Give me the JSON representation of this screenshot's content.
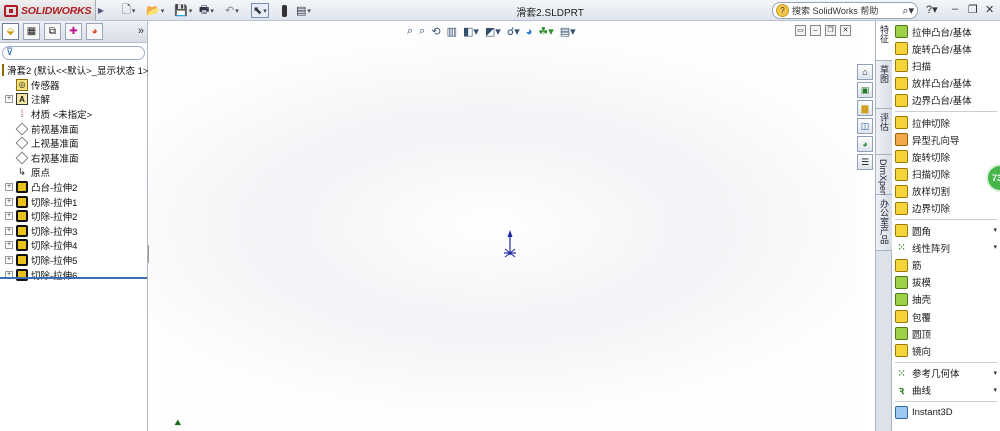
{
  "app": {
    "logo_text": "SOLIDWORKS",
    "document_title": "滑套2.SLDPRT",
    "search_placeholder": "搜索 SolidWorks 帮助",
    "help_label": "?"
  },
  "toolbar": {
    "icons": [
      "new-icon",
      "open-icon",
      "save-icon",
      "print-icon",
      "undo-icon",
      "select-icon",
      "traffic-light-icon",
      "options-icon"
    ]
  },
  "feature_tree": {
    "root_label": "滑套2 (默认<<默认>_显示状态 1>)",
    "nodes": [
      {
        "label": "传感器",
        "icon": "sensor-icon",
        "expandable": false
      },
      {
        "label": "注解",
        "icon": "annotation-icon",
        "expandable": true
      },
      {
        "label": "材质 <未指定>",
        "icon": "material-icon",
        "expandable": false
      },
      {
        "label": "前视基准面",
        "icon": "plane-icon",
        "expandable": false
      },
      {
        "label": "上视基准面",
        "icon": "plane-icon",
        "expandable": false
      },
      {
        "label": "右视基准面",
        "icon": "plane-icon",
        "expandable": false
      },
      {
        "label": "原点",
        "icon": "origin-icon",
        "expandable": false
      },
      {
        "label": "凸台-拉伸2",
        "icon": "boss-extrude-icon",
        "expandable": true
      },
      {
        "label": "切除-拉伸1",
        "icon": "cut-extrude-icon",
        "expandable": true
      },
      {
        "label": "切除-拉伸2",
        "icon": "cut-extrude-icon",
        "expandable": true
      },
      {
        "label": "切除-拉伸3",
        "icon": "cut-extrude-icon",
        "expandable": true
      },
      {
        "label": "切除-拉伸4",
        "icon": "cut-extrude-icon",
        "expandable": true
      },
      {
        "label": "切除-拉伸5",
        "icon": "cut-extrude-icon",
        "expandable": true
      },
      {
        "label": "切除-拉伸6",
        "icon": "cut-extrude-icon",
        "expandable": true
      }
    ]
  },
  "vertical_tabs": [
    "特征",
    "草图",
    "评估",
    "DimXpert",
    "办公室产品"
  ],
  "commands": [
    {
      "label": "拉伸凸台/基体",
      "icon": "extrude-boss-icon",
      "style": "g",
      "arrow": false
    },
    {
      "label": "旋转凸台/基体",
      "icon": "revolve-boss-icon",
      "style": "y",
      "arrow": false
    },
    {
      "label": "扫描",
      "icon": "sweep-icon",
      "style": "y",
      "arrow": false
    },
    {
      "label": "放样凸台/基体",
      "icon": "loft-boss-icon",
      "style": "y",
      "arrow": false
    },
    {
      "label": "边界凸台/基体",
      "icon": "boundary-boss-icon",
      "style": "y",
      "arrow": false
    },
    {
      "sep": true
    },
    {
      "label": "拉伸切除",
      "icon": "extrude-cut-icon",
      "style": "y",
      "arrow": false
    },
    {
      "label": "异型孔向导",
      "icon": "hole-wizard-icon",
      "style": "o",
      "arrow": false
    },
    {
      "label": "旋转切除",
      "icon": "revolve-cut-icon",
      "style": "y",
      "arrow": false
    },
    {
      "label": "扫描切除",
      "icon": "sweep-cut-icon",
      "style": "y",
      "arrow": false
    },
    {
      "label": "放样切割",
      "icon": "loft-cut-icon",
      "style": "y",
      "arrow": false
    },
    {
      "label": "边界切除",
      "icon": "boundary-cut-icon",
      "style": "y",
      "arrow": false
    },
    {
      "sep": true
    },
    {
      "label": "圆角",
      "icon": "fillet-icon",
      "style": "y",
      "arrow": true
    },
    {
      "label": "线性阵列",
      "icon": "linear-pattern-icon",
      "style": "dot",
      "arrow": true
    },
    {
      "label": "筋",
      "icon": "rib-icon",
      "style": "y",
      "arrow": false
    },
    {
      "label": "拔模",
      "icon": "draft-icon",
      "style": "g",
      "arrow": false
    },
    {
      "label": "抽壳",
      "icon": "shell-icon",
      "style": "g",
      "arrow": false
    },
    {
      "label": "包覆",
      "icon": "wrap-icon",
      "style": "y",
      "arrow": false
    },
    {
      "label": "圆顶",
      "icon": "dome-icon",
      "style": "g",
      "arrow": false
    },
    {
      "label": "镜向",
      "icon": "mirror-icon",
      "style": "y",
      "arrow": false
    },
    {
      "sep": true
    },
    {
      "label": "参考几何体",
      "icon": "reference-geometry-icon",
      "style": "dot",
      "arrow": true
    },
    {
      "label": "曲线",
      "icon": "curves-icon",
      "style": "curve",
      "arrow": true
    },
    {
      "sep": true
    },
    {
      "label": "Instant3D",
      "icon": "instant3d-icon",
      "style": "b",
      "arrow": false
    }
  ],
  "bubble_text": "73"
}
